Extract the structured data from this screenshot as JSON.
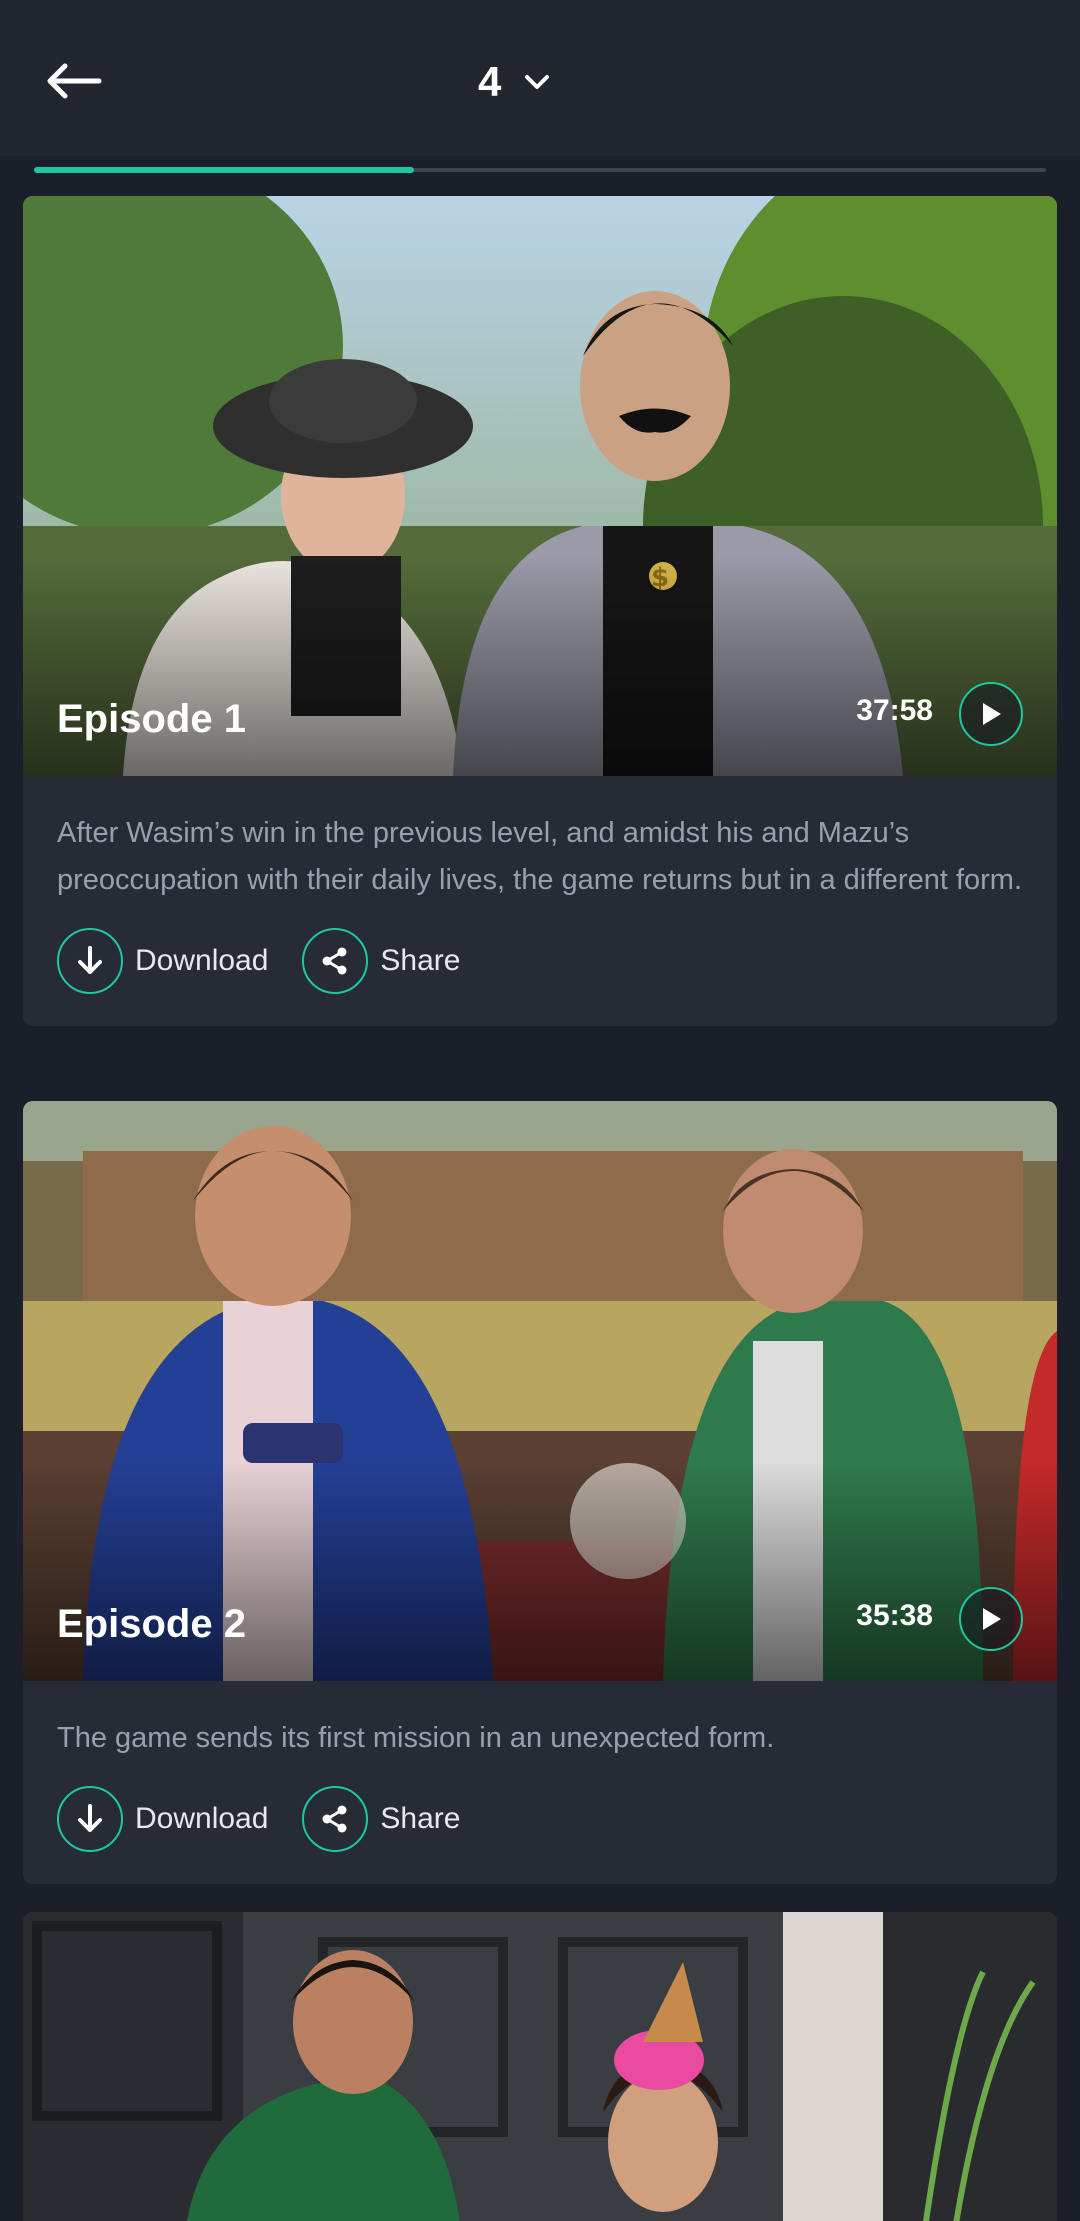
{
  "header": {
    "back_icon": "arrow-left-icon",
    "season_value": "4",
    "dropdown_icon": "chevron-down-icon"
  },
  "progress": {
    "fraction": 0.375,
    "fill_color": "#1ec89f",
    "track_color": "#3e434d"
  },
  "episodes": [
    {
      "title": "Episode 1",
      "duration": "37:58",
      "description": "After Wasim’s win in the previous level, and amidst his and Mazu’s preoccupation with their daily lives, the game returns but in a different form.",
      "download_label": "Download",
      "share_label": "Share"
    },
    {
      "title": "Episode 2",
      "duration": "35:38",
      "description": "The game sends its first mission in an unexpected form.",
      "download_label": "Download",
      "share_label": "Share"
    }
  ],
  "colors": {
    "accent": "#1ec89f",
    "background": "#1b1f2a",
    "card": "#262b36"
  }
}
